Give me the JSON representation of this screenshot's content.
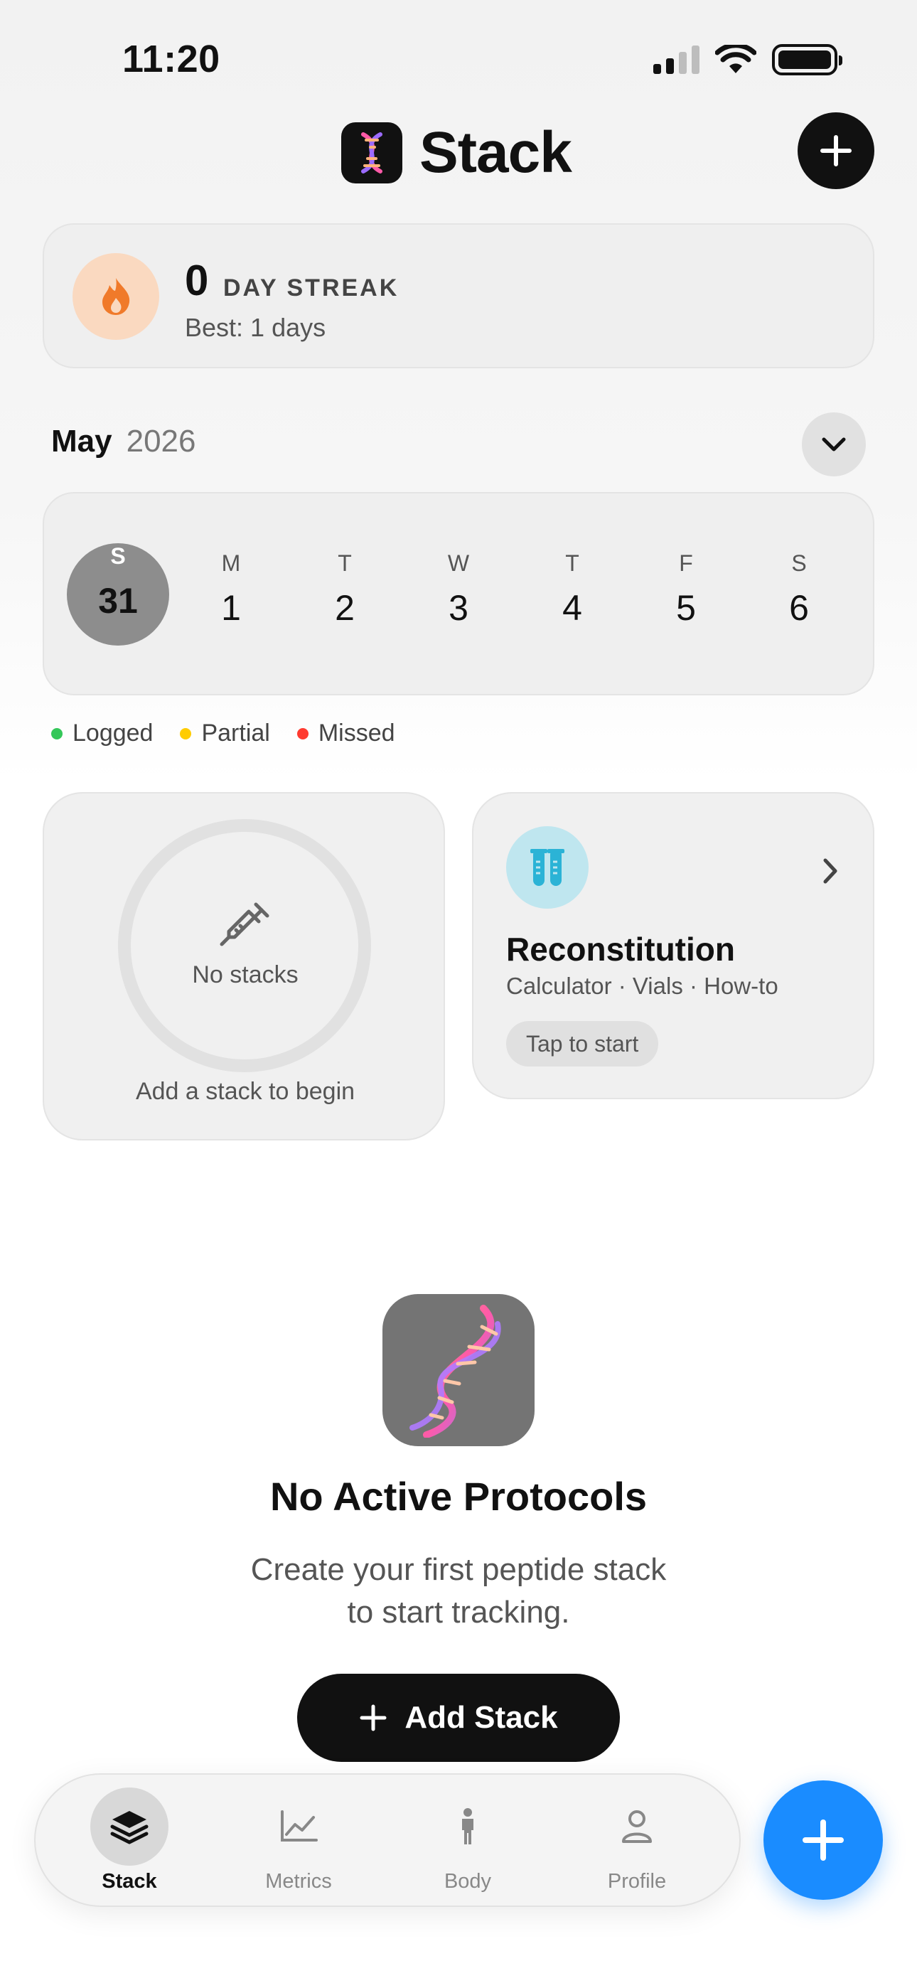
{
  "status_bar": {
    "time": "11:20",
    "icons": [
      "cellular-signal-icon",
      "wifi-icon",
      "battery-icon"
    ]
  },
  "header": {
    "title": "Stack",
    "logo_icon": "dna-icon",
    "add_icon": "plus-icon"
  },
  "streak": {
    "count": "0",
    "label": "DAY STREAK",
    "best": "Best: 1 days",
    "icon": "flame-icon"
  },
  "calendar": {
    "month": "May",
    "year": "2026",
    "toggle_icon": "chevron-down-icon",
    "days": [
      {
        "letter": "S",
        "num": "31",
        "selected": true
      },
      {
        "letter": "M",
        "num": "1"
      },
      {
        "letter": "T",
        "num": "2"
      },
      {
        "letter": "W",
        "num": "3"
      },
      {
        "letter": "T",
        "num": "4"
      },
      {
        "letter": "F",
        "num": "5"
      },
      {
        "letter": "S",
        "num": "6"
      }
    ]
  },
  "legend": [
    {
      "label": "Logged",
      "color": "#34c759"
    },
    {
      "label": "Partial",
      "color": "#ffcc00"
    },
    {
      "label": "Missed",
      "color": "#ff3b30"
    }
  ],
  "stacks_card": {
    "empty_text": "No stacks",
    "hint": "Add a stack to begin",
    "icon": "syringe-icon"
  },
  "reconstitution_card": {
    "title": "Reconstitution",
    "subtitle": "Calculator · Vials · How-to",
    "cta": "Tap to start",
    "icon": "test-tubes-icon"
  },
  "empty_state": {
    "title": "No Active Protocols",
    "desc_line1": "Create your first peptide stack",
    "desc_line2": "to start tracking.",
    "button": "Add Stack"
  },
  "tabs": [
    {
      "label": "Stack",
      "icon": "layers-icon",
      "active": true
    },
    {
      "label": "Metrics",
      "icon": "chart-icon"
    },
    {
      "label": "Body",
      "icon": "body-icon"
    },
    {
      "label": "Profile",
      "icon": "person-icon"
    }
  ],
  "colors": {
    "accent": "#1a8cff",
    "flame": "#f07a2a",
    "tube": "#2bb3d6"
  }
}
